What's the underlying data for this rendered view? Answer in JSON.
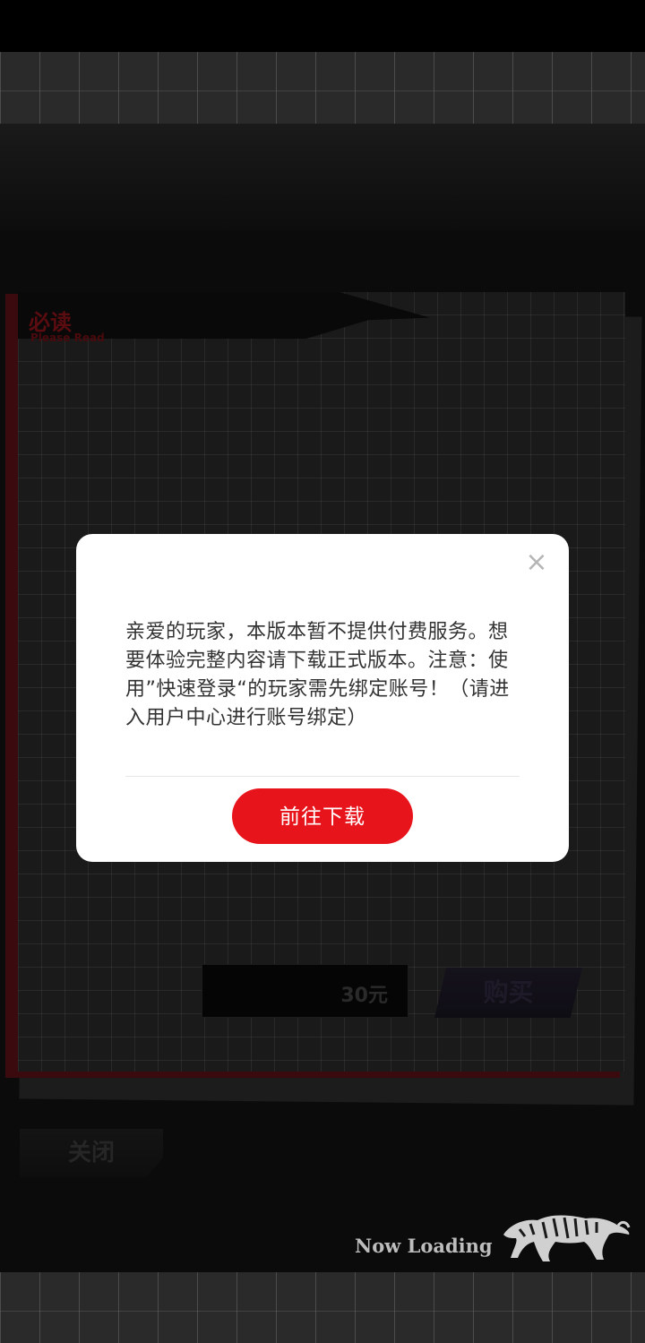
{
  "background": {
    "panel": {
      "title": "必读",
      "subtitle": "Please Read"
    },
    "price": "30元",
    "buy_label": "购买",
    "close_label": "关闭",
    "loading_text": "Now Loading"
  },
  "modal": {
    "close_icon": "×",
    "message": "亲爱的玩家，本版本暂不提供付费服务。想要体验完整内容请下载正式版本。注意：使用”快速登录“的玩家需先绑定账号！（请进入用户中心进行账号绑定）",
    "button_label": "前往下载",
    "accent_color": "#e8141c"
  }
}
